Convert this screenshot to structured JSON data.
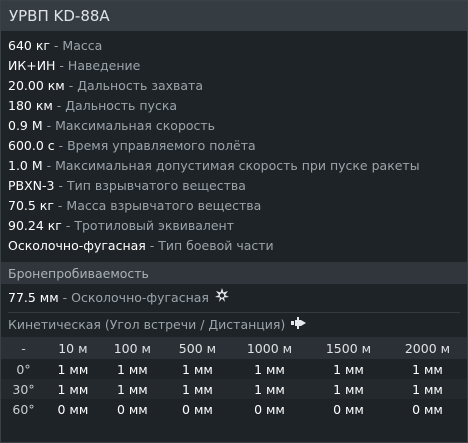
{
  "title": "УРВП KD-88A",
  "separator": " - ",
  "stats": [
    {
      "value": "640 кг",
      "label": "Масса"
    },
    {
      "value": "ИК+ИН",
      "label": "Наведение"
    },
    {
      "value": "20.00 км",
      "label": "Дальность захвата"
    },
    {
      "value": "180 км",
      "label": "Дальность пуска"
    },
    {
      "value": "0.9 М",
      "label": "Максимальная скорость"
    },
    {
      "value": "600.0 с",
      "label": "Время управляемого полёта"
    },
    {
      "value": "1.0 М",
      "label": "Максимальная допустимая скорость при пуске ракеты"
    },
    {
      "value": "PBXN-3",
      "label": "Тип взрывчатого вещества"
    },
    {
      "value": "70.5 кг",
      "label": "Масса взрывчатого вещества"
    },
    {
      "value": "90.24 кг",
      "label": "Тротиловый эквивалент"
    },
    {
      "value": "Осколочно-фугасная",
      "label": "Тип боевой части"
    }
  ],
  "armor_section": {
    "title": "Бронепробиваемость",
    "he_value": "77.5 мм",
    "he_label": "Осколочно-фугасная",
    "he_icon": "explosion-icon"
  },
  "kinetic": {
    "title": "Кинетическая (Угол встречи / Дистанция)",
    "icon": "shell-icon",
    "headers": [
      "-",
      "10 м",
      "100 м",
      "500 м",
      "1000 м",
      "1500 м",
      "2000 м"
    ],
    "rows": [
      {
        "angle": "0°",
        "values": [
          "1 мм",
          "1 мм",
          "1 мм",
          "1 мм",
          "1 мм",
          "1 мм"
        ]
      },
      {
        "angle": "30°",
        "values": [
          "1 мм",
          "1 мм",
          "1 мм",
          "1 мм",
          "1 мм",
          "1 мм"
        ]
      },
      {
        "angle": "60°",
        "values": [
          "0 мм",
          "0 мм",
          "0 мм",
          "0 мм",
          "0 мм",
          "0 мм"
        ]
      }
    ]
  },
  "colors": {
    "value": "#ffffff",
    "label": "#9ba4ab",
    "header_bg": "#353c42"
  }
}
